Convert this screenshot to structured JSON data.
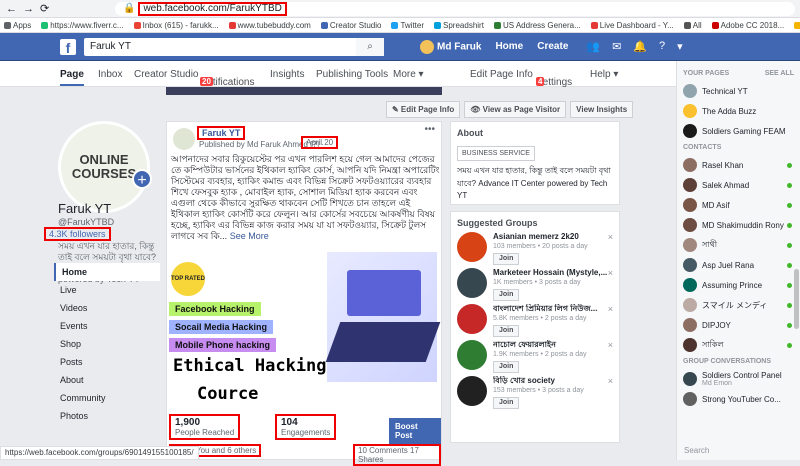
{
  "browser": {
    "url": "web.facebook.com/FarukYTBD",
    "bookmarks": [
      {
        "label": "Apps",
        "color": "#5f6368"
      },
      {
        "label": "https://www.fiverr.c...",
        "color": "#1dbf73"
      },
      {
        "label": "Inbox (615) - farukk...",
        "color": "#ea4335"
      },
      {
        "label": "www.tubebuddy.com",
        "color": "#e53935"
      },
      {
        "label": "Creator Studio",
        "color": "#4267b2"
      },
      {
        "label": "Twitter",
        "color": "#1da1f2"
      },
      {
        "label": "Spreadshirt",
        "color": "#00a0dc"
      },
      {
        "label": "US Address Genera...",
        "color": "#2e7d32"
      },
      {
        "label": "Live Dashboard - Y...",
        "color": "#e53935"
      },
      {
        "label": "All",
        "color": "#555555"
      },
      {
        "label": "Adobe CC 2018...",
        "color": "#cc0000"
      },
      {
        "label": "Other bookmarks",
        "color": "#f5b400"
      }
    ],
    "status_url": "https://web.facebook.com/groups/690149155100185/"
  },
  "fb": {
    "search_value": "Faruk YT",
    "user": "Md Faruk",
    "nav": [
      "Home",
      "Create"
    ]
  },
  "page_nav": {
    "items": [
      "Page",
      "Inbox",
      "Creator Studio",
      "Notifications",
      "Insights",
      "Publishing Tools",
      "More ▾",
      "Edit Page Info",
      "Settings",
      "Help ▾"
    ],
    "notif_badge": "20",
    "settings_badge": "4"
  },
  "profile": {
    "pic_text_1": "ONLINE",
    "pic_text_2": "COURSES",
    "name": "Faruk YT",
    "handle": "@FarukYTBD",
    "followers": "4.3K followers",
    "about": "সময় এখন যার হাতার, কিন্তু তাই বলে সময়টা বৃথা যাবে? Advance IT Center powered by Tech YT",
    "menu": [
      "Home",
      "Live",
      "Videos",
      "Events",
      "Shop",
      "Posts",
      "About",
      "Community",
      "Photos"
    ]
  },
  "actions": {
    "edit": "✎ Edit Page Info",
    "visitor": "👁 View as Page Visitor",
    "insights": "View Insights"
  },
  "post": {
    "name": "Faruk YT",
    "published_by": "Published by Md Faruk Ahmed [?] ·",
    "date": "April 20",
    "text": "আপনাদের সবার রিকুয়েস্টের পর এখন পারলিশ হয়ে গেল আমাদের পেজের তে কম্পিউটার ভার্সনের ইথিকাল হ্যাকিং কোর্স, আপনি যদি নিমন্ত্রা অপারেটিং সিস্টেমের ব্যবহার, হ্যাকিং কমান্ড এবং বিভিন্ন সিক্রেট সফটওয়্যারের ব্যবহার শিখে ফেসবুক হ্যাক , মোবাইল হ্যাক, সোশাল মিডিয়া হ্যাক করবেন এবং এগুলা থেকে কীভাবে সুরক্ষিত থাকবেন সেটি শিখতে চান তাহলে এই ইথিকাল হ্যাকিং কোর্সটি করে ফেলুন। আর কোর্সের সবচেয়ে আকর্ষণীয় বিষয় হচ্ছে, হ্যাকিং এর বিভিন্ন কাজ করার সময় যা যা সফটওয়্যার, সিক্রেট টুলস লাগবে সব কি...",
    "see_more": "See More",
    "image": {
      "badge": "TOP RATED",
      "ribbons": [
        "Facebook Hacking",
        "Socail Media Hacking",
        "Mobile Phone hacking"
      ],
      "ribbon_colors": [
        "#b6f26b",
        "#9fb2ff",
        "#c68cf0"
      ],
      "title_1": "Ethical Hacking",
      "title_2": "Cource"
    },
    "reach": "1,900",
    "reach_label": "People Reached",
    "engagements": "104",
    "engagements_label": "Engagements",
    "boost": "Boost Post",
    "reactions": "You and 6 others",
    "comments_shares": "10 Comments  17 Shares"
  },
  "about_box": {
    "title": "About",
    "category": "BUSINESS SERVICE",
    "text": "সময় এখন যার হাতার, কিন্তু তাই বলে সময়টা বৃথা যাবে? Advance IT Center powered by Tech YT"
  },
  "groups": {
    "title": "Suggested Groups",
    "join": "Join",
    "items": [
      {
        "name": "Asianian memerz 2k20",
        "meta": "103 members • 20 posts a day",
        "color": "#d84315"
      },
      {
        "name": "Marketeer Hossain (Mystyle,...",
        "meta": "1K members • 3 posts a day",
        "color": "#37474f"
      },
      {
        "name": "বাংলাদেশ প্রিমিয়ার লিগ নিউজ...",
        "meta": "5.8K members • 2 posts a day",
        "color": "#c62828"
      },
      {
        "name": "নাচোল ফেয়ারলাইন",
        "meta": "1.9K members • 2 posts a day",
        "color": "#2e7d32"
      },
      {
        "name": "বিড়ি খোর society",
        "meta": "153 members • 3 posts a day",
        "color": "#212121"
      }
    ]
  },
  "sidebar": {
    "your_pages": "YOUR PAGES",
    "see_all": "SEE ALL",
    "pages": [
      {
        "name": "Technical YT",
        "color": "#90a4ae"
      },
      {
        "name": "The Adda Buzz",
        "color": "#fbc02d"
      },
      {
        "name": "Soldiers Gaming FEAM",
        "color": "#1a1a1a"
      }
    ],
    "contacts_title": "CONTACTS",
    "contacts": [
      {
        "name": "Rasel Khan",
        "color": "#8d6e63"
      },
      {
        "name": "Salek Ahmad",
        "color": "#5d4037"
      },
      {
        "name": "MD Asif",
        "color": "#795548"
      },
      {
        "name": "MD Shakimuddin Rony",
        "color": "#6d4c41"
      },
      {
        "name": "সাথী",
        "color": "#a1887f"
      },
      {
        "name": "Asp Juel Rana",
        "color": "#455a64"
      },
      {
        "name": "Assuming Prince",
        "color": "#00695c"
      },
      {
        "name": "スマイル メンディ",
        "color": "#bcaaa4"
      },
      {
        "name": "DIPJOY",
        "color": "#8d6e63"
      },
      {
        "name": "সাকিল",
        "color": "#4e342e"
      }
    ],
    "group_conv_title": "GROUP CONVERSATIONS",
    "group_convs": [
      {
        "name": "Soldiers Control Panel",
        "sub": "Md Emon",
        "color": "#37474f"
      },
      {
        "name": "Strong YouTuber Co...",
        "sub": "",
        "color": "#616161"
      }
    ],
    "search": "Search"
  }
}
